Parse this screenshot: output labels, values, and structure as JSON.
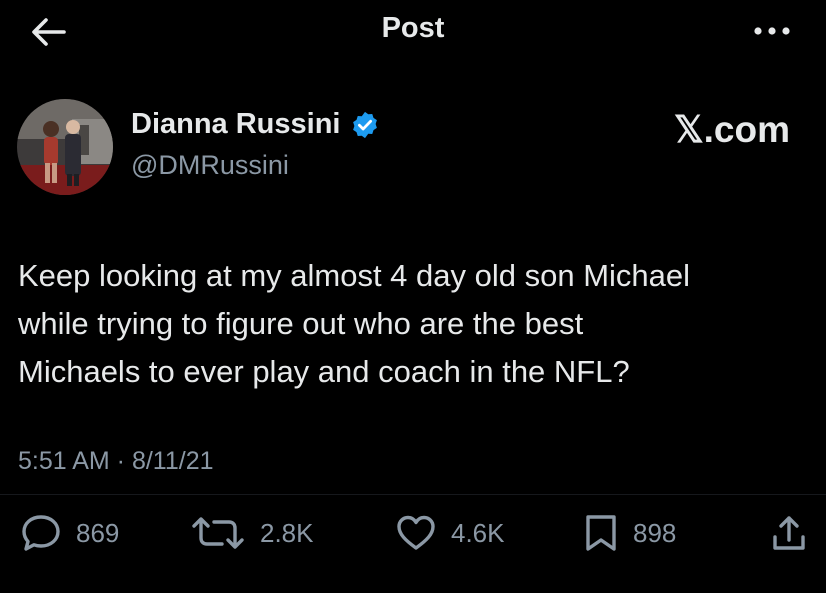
{
  "header": {
    "title": "Post",
    "back_icon": "arrow-left-icon",
    "more_icon": "more-horizontal-icon"
  },
  "author": {
    "name": "Dianna Russini",
    "handle": "@DMRussini",
    "verified": true,
    "verified_color": "#1d9bf0",
    "avatar_icon": "avatar-photo"
  },
  "watermark": "𝕏.com",
  "tweet": {
    "text": "Keep looking at my almost 4 day old son Michael\nwhile trying to figure out who are the best\nMichaels to ever play and coach in the NFL?",
    "timestamp": "5:51 AM · 8/11/21"
  },
  "actions": {
    "reply": {
      "icon": "reply-icon",
      "count": "869"
    },
    "repost": {
      "icon": "repost-icon",
      "count": "2.8K"
    },
    "like": {
      "icon": "heart-icon",
      "count": "4.6K"
    },
    "bookmark": {
      "icon": "bookmark-icon",
      "count": "898"
    },
    "share": {
      "icon": "share-icon"
    }
  },
  "colors": {
    "background": "#000000",
    "primary_text": "#e7e9ea",
    "secondary_text": "#8b98a5",
    "accent": "#1d9bf0"
  }
}
